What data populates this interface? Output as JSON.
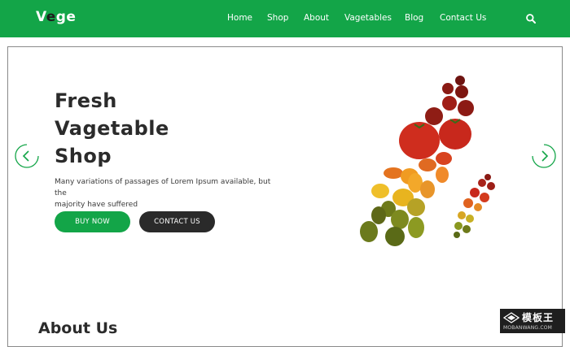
{
  "header": {
    "logo_prefix": "V",
    "logo_accent": "e",
    "logo_suffix": "ge",
    "nav": [
      "Home",
      "Shop",
      "About",
      "Vagetables",
      "Blog",
      "Contact Us"
    ]
  },
  "hero": {
    "title_line1": "Fresh",
    "title_line2": "Vagetable",
    "title_line3": "Shop",
    "description_line1": "Many variations of passages of Lorem Ipsum available, but the",
    "description_line2": "majority have suffered",
    "buy_label": "BUY NOW",
    "contact_label": "CONTACT US"
  },
  "about": {
    "heading": "About Us"
  },
  "watermark": {
    "cn": "模板王",
    "en": "MOBANWANG.COM"
  },
  "colors": {
    "brand_green": "#13a548",
    "dark": "#2a2a2a",
    "tomato_red": "#c8281c",
    "olive": "#6e7a1a"
  }
}
